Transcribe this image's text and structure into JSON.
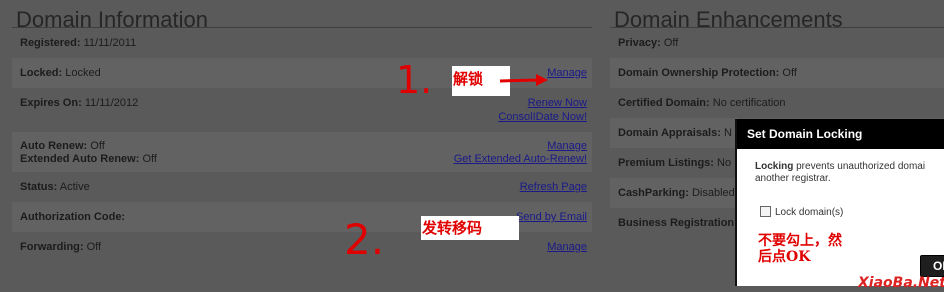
{
  "domain_info": {
    "title": "Domain Information",
    "registered_label": "Registered:",
    "registered_value": "11/11/2011",
    "locked_label": "Locked:",
    "locked_value": "Locked",
    "locked_link": "Manage",
    "expires_label": "Expires On:",
    "expires_value": "11/11/2012",
    "renew_link": "Renew Now",
    "consolidate_link": "ConsolIDate Now!",
    "auto_renew_label": "Auto Renew:",
    "auto_renew_value": "Off",
    "ext_auto_renew_label": "Extended Auto Renew:",
    "ext_auto_renew_value": "Off",
    "auto_renew_link": "Manage",
    "ext_auto_renew_link": "Get Extended Auto-Renew!",
    "status_label": "Status:",
    "status_value": "Active",
    "refresh_link": "Refresh Page",
    "auth_code_label": "Authorization Code:",
    "auth_code_link": "Send by Email",
    "forwarding_label": "Forwarding:",
    "forwarding_value": "Off",
    "forwarding_link": "Manage"
  },
  "enhancements": {
    "title": "Domain Enhancements",
    "privacy_label": "Privacy:",
    "privacy_value": "Off",
    "ownership_label": "Domain Ownership Protection:",
    "ownership_value": "Off",
    "certified_label": "Certified Domain:",
    "certified_value": "No certification",
    "appraisals_label": "Domain Appraisals:",
    "appraisals_value": "N",
    "premium_label": "Premium Listings:",
    "premium_value": "No",
    "cashparking_label": "CashParking:",
    "cashparking_value": "Disabled",
    "business_label": "Business Registration"
  },
  "dialog": {
    "title": "Set Domain Locking",
    "desc_bold": "Locking",
    "desc_rest": "prevents unauthorized domai",
    "desc_line2": "another registrar.",
    "checkbox_label": "Lock domain(s)",
    "ok_label": "OK"
  },
  "annotations": {
    "step1_number": "1.",
    "step1_text": "解锁",
    "step2_number": "2.",
    "step2_text": "发转移码",
    "dialog_note_line1": "不要勾上，然",
    "dialog_note_line2": "后点OK",
    "watermark": "XiaoBa.Net"
  },
  "colors": {
    "overlay_background": "#5a5a5a",
    "link": "#1a1a8a",
    "annotation_red": "#e00000",
    "dialog_titlebar": "#000000"
  }
}
